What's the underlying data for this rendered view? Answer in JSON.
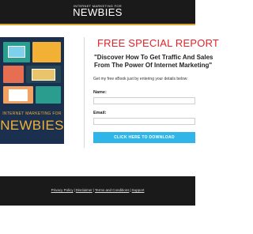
{
  "header": {
    "logo_small": "INTERNET MARKETING FOR",
    "logo_big": "NEWBIES"
  },
  "cover": {
    "title_small": "INTERNET MARKETING FOR",
    "title_big": "NEWBIES"
  },
  "offer": {
    "headline": "FREE SPECIAL REPORT",
    "subhead_line1": "\"Discover How To Get Traffic And Sales",
    "subhead_line2": "From The Power Of Internet Marketing\"",
    "lead": "Get my free eBook just by entering your details below:"
  },
  "form": {
    "name_label": "Name:",
    "name_value": "",
    "email_label": "Email:",
    "email_value": "",
    "submit_label": "CLICK HERE TO DOWNLOAD"
  },
  "footer": {
    "links": [
      "Privacy Policy",
      "Disclaimer",
      "Terms and Conditions",
      "Support"
    ],
    "separator": "|"
  },
  "colors": {
    "accent_gold": "#d9a531",
    "headline_red": "#e0242a",
    "button_blue": "#2fb5e8",
    "dark_bg": "#1a1a1a"
  }
}
